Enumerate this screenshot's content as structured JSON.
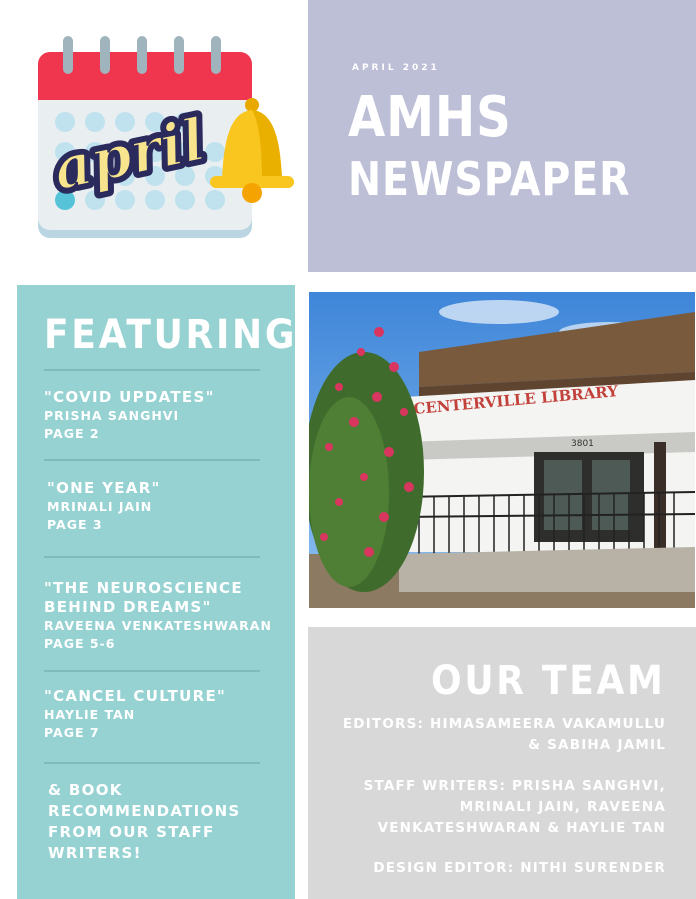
{
  "calendar": {
    "month_script": "april"
  },
  "header": {
    "issue_date": "APRIL 2021",
    "title_line1": "AMHS",
    "title_line2": "NEWSPAPER"
  },
  "featuring": {
    "heading": "FEATURING",
    "articles": [
      {
        "title": "\"COVID UPDATES\"",
        "author": "PRISHA SANGHVI",
        "page": "PAGE 2"
      },
      {
        "title": "\"ONE YEAR\"",
        "author": "MRINALI JAIN",
        "page": "PAGE 3"
      },
      {
        "title_line1": "\"THE NEUROSCIENCE",
        "title_line2": "BEHIND DREAMS\"",
        "author": "RAVEENA VENKATESHWARAN",
        "page": "PAGE 5-6"
      },
      {
        "title": "\"CANCEL CULTURE\"",
        "author": "HAYLIE TAN",
        "page": "PAGE 7"
      }
    ],
    "extra_lines": [
      "& BOOK",
      "RECOMMENDATIONS",
      "FROM OUR STAFF",
      "WRITERS!"
    ]
  },
  "photo": {
    "sign_text": "CENTERVILLE LIBRARY",
    "address_number": "3801"
  },
  "team": {
    "heading": "OUR TEAM",
    "editors_lines": [
      "EDITORS: HIMASAMEERA VAKAMULLU",
      "& SABIHA JAMIL"
    ],
    "writers_lines": [
      "STAFF WRITERS: PRISHA SANGHVI,",
      "MRINALI JAIN, RAVEENA",
      "VENKATESHWARAN & HAYLIE TAN"
    ],
    "design_line": "DESIGN EDITOR: NITHI SURENDER"
  },
  "colors": {
    "header_panel": "#bcbfd6",
    "featuring_panel": "#97d2d3",
    "team_panel": "#d8d8d8",
    "calendar_red": "#f0354f",
    "bell_yellow": "#f8c61e"
  }
}
